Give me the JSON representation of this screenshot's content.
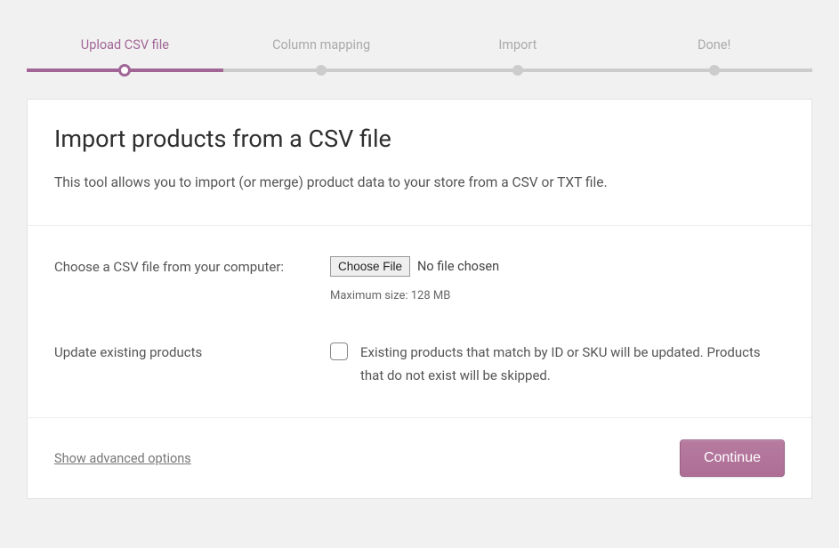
{
  "progress": {
    "steps": [
      {
        "label": "Upload CSV file",
        "active": true
      },
      {
        "label": "Column mapping",
        "active": false
      },
      {
        "label": "Import",
        "active": false
      },
      {
        "label": "Done!",
        "active": false
      }
    ]
  },
  "header": {
    "title": "Import products from a CSV file",
    "description": "This tool allows you to import (or merge) product data to your store from a CSV or TXT file."
  },
  "form": {
    "file": {
      "label": "Choose a CSV file from your computer:",
      "button": "Choose File",
      "status": "No file chosen",
      "hint": "Maximum size: 128 MB"
    },
    "update": {
      "label": "Update existing products",
      "description": "Existing products that match by ID or SKU will be updated. Products that do not exist will be skipped."
    }
  },
  "footer": {
    "advanced": "Show advanced options",
    "continue": "Continue"
  }
}
